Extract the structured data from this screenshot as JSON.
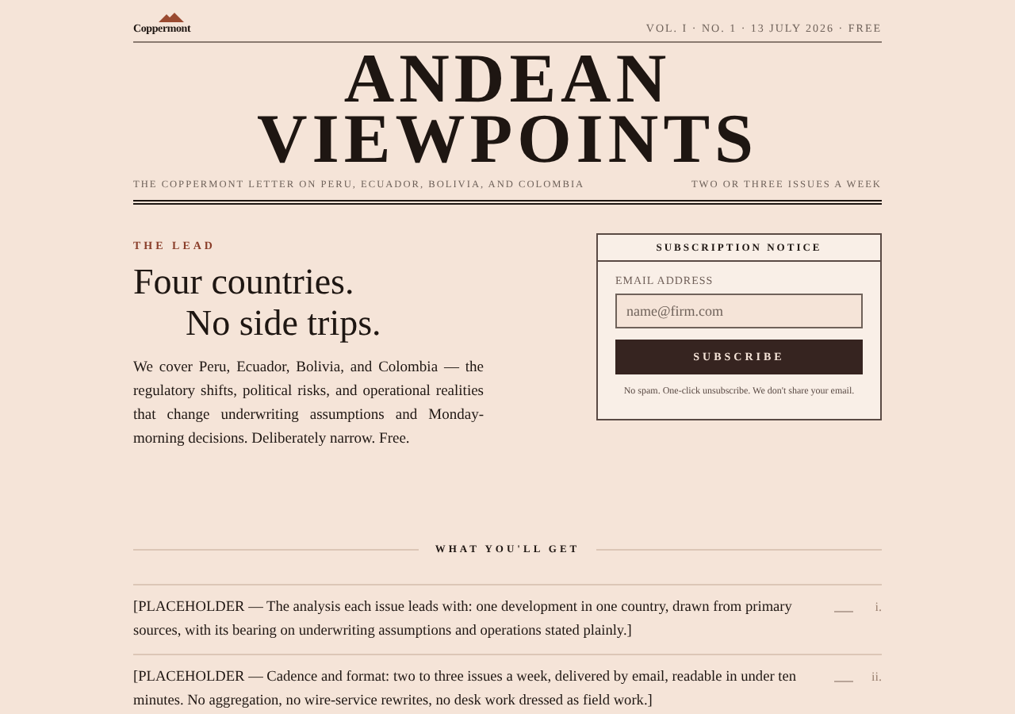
{
  "masthead": {
    "logo": "Coppermont",
    "issue_line": "VOL. I · NO. 1 · 13 JULY 2026 · FREE",
    "title_lines": [
      "ANDEAN",
      "VIEWPOINTS"
    ],
    "tagline": "THE COPPERMONT LETTER ON PERU, ECUADOR, BOLIVIA, AND COLOMBIA",
    "frequency": "TWO OR THREE ISSUES A WEEK"
  },
  "lead": {
    "kicker": "THE LEAD",
    "headline_lines": [
      "Four countries.",
      "No side trips."
    ],
    "body": "We cover Peru, Ecuador, Bolivia, and Colombia — the regulatory shifts, political risks, and operational realities that change underwriting assumptions and Monday-morning decisions. Deliberately narrow. Free."
  },
  "subscription": {
    "title": "SUBSCRIPTION NOTICE",
    "field_label": "EMAIL ADDRESS",
    "placeholder": "name@firm.com",
    "button": "SUBSCRIBE",
    "note": "No spam. One-click unsubscribe. We don't share your email."
  },
  "features": {
    "title": "WHAT YOU'LL GET",
    "items": [
      {
        "text": "[PLACEHOLDER — The analysis each issue leads with: one development in one country, drawn from primary sources, with its bearing on underwriting assumptions and operations stated plainly.]",
        "numeral": "i."
      },
      {
        "text": "[PLACEHOLDER — Cadence and format: two to three issues a week, delivered by email, readable in under ten minutes. No aggregation, no wire-service rewrites, no desk work dressed as field work.]",
        "numeral": "ii."
      }
    ]
  }
}
